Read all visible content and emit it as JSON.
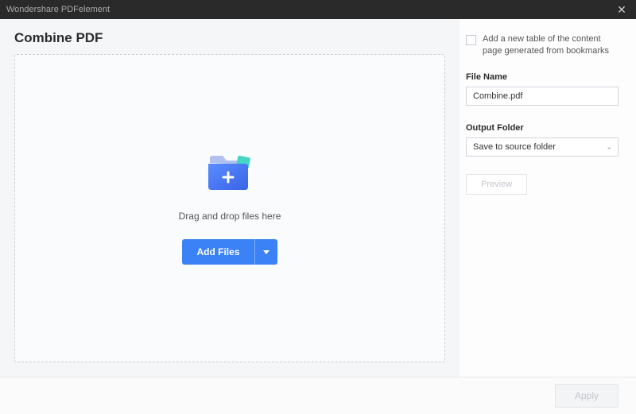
{
  "window": {
    "title": "Wondershare PDFelement"
  },
  "main": {
    "page_title": "Combine PDF",
    "drop_text": "Drag and drop files here",
    "add_files_label": "Add Files"
  },
  "sidebar": {
    "checkbox_label": "Add a new table of the content page generated from bookmarks",
    "file_name_label": "File Name",
    "file_name_value": "Combine.pdf",
    "output_folder_label": "Output Folder",
    "output_folder_value": "Save to source folder",
    "preview_label": "Preview"
  },
  "footer": {
    "apply_label": "Apply"
  }
}
